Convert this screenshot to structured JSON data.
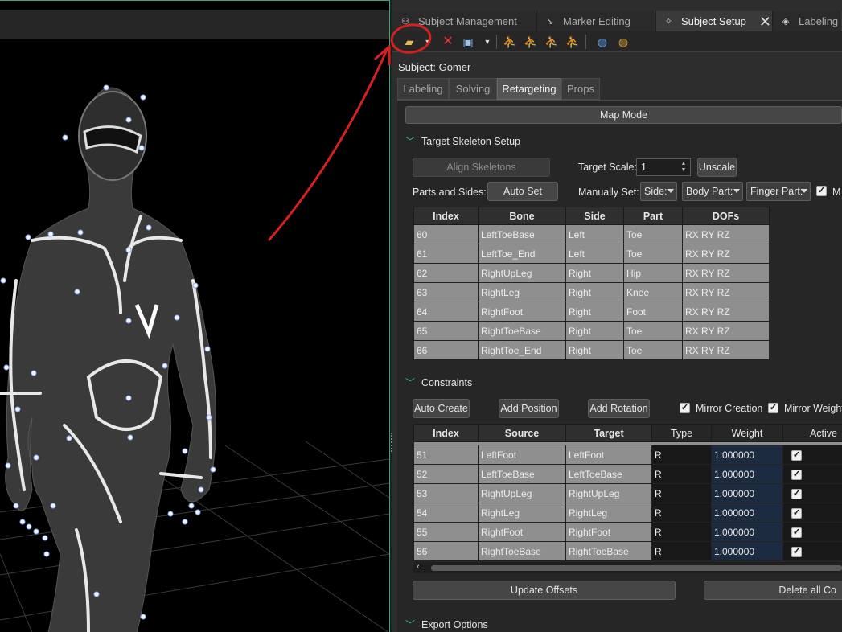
{
  "tabs": [
    {
      "label": "Subject Management",
      "icon": "people-icon",
      "active": false
    },
    {
      "label": "Marker Editing",
      "icon": "marker-edit-icon",
      "active": false
    },
    {
      "label": "Subject Setup",
      "icon": "subject-setup-icon",
      "active": true
    },
    {
      "label": "Labeling",
      "icon": "label-tag-icon",
      "active": false
    }
  ],
  "toolbar": {
    "icons": [
      "open-folder-icon",
      "dropdown-icon",
      "delete-icon",
      "save-icon",
      "dropdown-icon",
      "skeleton-icon-1",
      "skeleton-icon-2",
      "skeleton-icon-3",
      "skeleton-remove-icon",
      "globe-icon-1",
      "globe-icon-2"
    ]
  },
  "subject": {
    "label": "Subject: Gomer"
  },
  "subtabs": [
    "Labeling",
    "Solving",
    "Retargeting",
    "Props"
  ],
  "map_mode": "Map Mode",
  "target_skeleton": {
    "title": "Target Skeleton Setup",
    "align_label": "Align Skeletons",
    "target_scale_label": "Target Scale:",
    "target_scale_value": "1",
    "unscale_label": "Unscale",
    "parts_sides_label": "Parts and Sides:",
    "auto_set_label": "Auto Set",
    "manually_set_label": "Manually Set:",
    "side_combo": "Side:",
    "body_part_combo": "Body Part:",
    "finger_part_combo": "Finger Part:",
    "trailing_check_label": "M",
    "columns": [
      "Index",
      "Bone",
      "Side",
      "Part",
      "DOFs"
    ],
    "rows": [
      [
        "60",
        "LeftToeBase",
        "Left",
        "Toe",
        "RX RY RZ"
      ],
      [
        "61",
        "LeftToe_End",
        "Left",
        "Toe",
        "RX RY RZ"
      ],
      [
        "62",
        "RightUpLeg",
        "Right",
        "Hip",
        "RX RY RZ"
      ],
      [
        "63",
        "RightLeg",
        "Right",
        "Knee",
        "RX RY RZ"
      ],
      [
        "64",
        "RightFoot",
        "Right",
        "Foot",
        "RX RY RZ"
      ],
      [
        "65",
        "RightToeBase",
        "Right",
        "Toe",
        "RX RY RZ"
      ],
      [
        "66",
        "RightToe_End",
        "Right",
        "Toe",
        "RX RY RZ"
      ]
    ]
  },
  "constraints": {
    "title": "Constraints",
    "auto_create": "Auto Create",
    "add_position": "Add Position",
    "add_rotation": "Add Rotation",
    "mirror_creation": "Mirror Creation",
    "mirror_weight": "Mirror Weight",
    "columns": [
      "Index",
      "Source",
      "Target",
      "Type",
      "Weight",
      "Active"
    ],
    "rows": [
      [
        "51",
        "LeftFoot",
        "LeftFoot",
        "R",
        "1.000000"
      ],
      [
        "52",
        "LeftToeBase",
        "LeftToeBase",
        "R",
        "1.000000"
      ],
      [
        "53",
        "RightUpLeg",
        "RightUpLeg",
        "R",
        "1.000000"
      ],
      [
        "54",
        "RightLeg",
        "RightLeg",
        "R",
        "1.000000"
      ],
      [
        "55",
        "RightFoot",
        "RightFoot",
        "R",
        "1.000000"
      ],
      [
        "56",
        "RightToeBase",
        "RightToeBase",
        "R",
        "1.000000"
      ]
    ],
    "update_offsets": "Update Offsets",
    "delete_all": "Delete all Co"
  },
  "export_options": {
    "title": "Export Options"
  },
  "colors": {
    "accent": "#2fc08e",
    "annotation": "#d42020"
  }
}
